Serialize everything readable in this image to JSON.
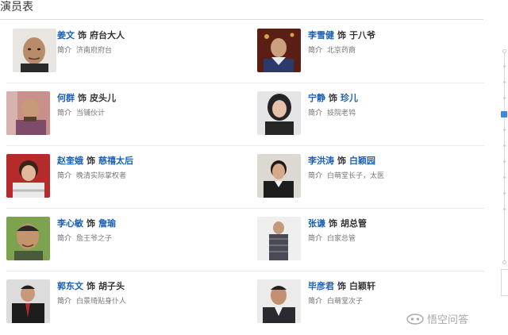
{
  "page": {
    "title": "演员表"
  },
  "rows": [
    {
      "left": {
        "actor": "姜文",
        "shi": "饰",
        "role": "府台大人",
        "role_link": false,
        "intro_label": "简介",
        "intro": "济南府府台"
      },
      "right": {
        "actor": "李雪健",
        "shi": "饰",
        "role": "于八爷",
        "role_link": false,
        "intro_label": "简介",
        "intro": "北京药商"
      }
    },
    {
      "left": {
        "actor": "何群",
        "shi": "饰",
        "role": "皮头儿",
        "role_link": false,
        "intro_label": "简介",
        "intro": "当铺伙计"
      },
      "right": {
        "actor": "宁静",
        "shi": "饰",
        "role": "珍儿",
        "role_link": true,
        "intro_label": "简介",
        "intro": "妓院老鸨"
      }
    },
    {
      "left": {
        "actor": "赵奎娥",
        "shi": "饰",
        "role": "慈禧太后",
        "role_link": true,
        "intro_label": "简介",
        "intro": "晚清实际掌权者"
      },
      "right": {
        "actor": "李洪涛",
        "shi": "饰",
        "role": "白颖园",
        "role_link": true,
        "intro_label": "简介",
        "intro": "白萌堂长子，太医"
      }
    },
    {
      "left": {
        "actor": "李心敏",
        "shi": "饰",
        "role": "詹瑜",
        "role_link": true,
        "intro_label": "简介",
        "intro": "詹王爷之子"
      },
      "right": {
        "actor": "张谦",
        "shi": "饰",
        "role": "胡总管",
        "role_link": false,
        "intro_label": "简介",
        "intro": "白家总管"
      }
    },
    {
      "left": {
        "actor": "郭东文",
        "shi": "饰",
        "role": "胡子头",
        "role_link": false,
        "intro_label": "简介",
        "intro": "白景琦贴身仆人"
      },
      "right": {
        "actor": "毕彦君",
        "shi": "饰",
        "role": "白颖轩",
        "role_link": false,
        "intro_label": "简介",
        "intro": "白萌堂次子"
      }
    }
  ],
  "watermark": {
    "text": "悟空问答"
  },
  "colors": {
    "link": "#1a5fb4",
    "accent": "#3c8ae0",
    "divider": "#ececec"
  }
}
